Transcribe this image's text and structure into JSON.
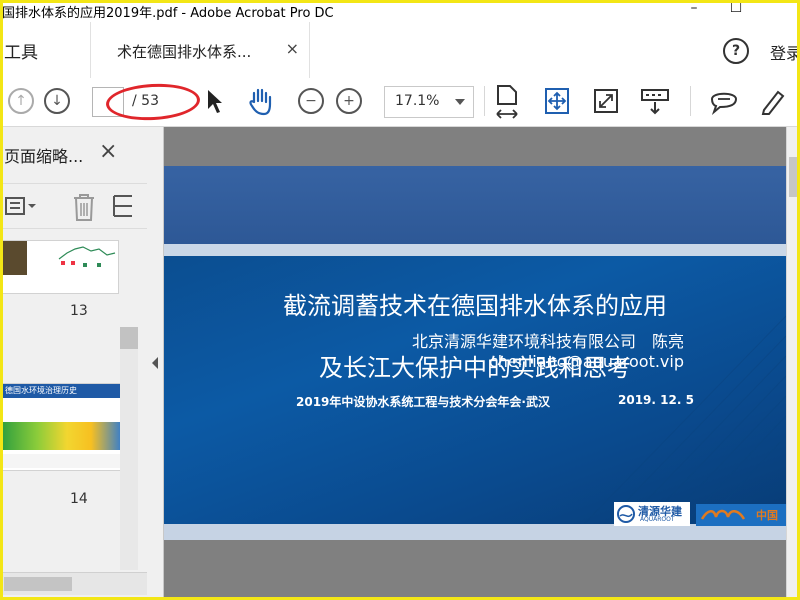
{
  "window": {
    "title": "国排水体系的应用2019年.pdf - Adobe Acrobat Pro DC",
    "controls": {
      "minimize": "–",
      "maximize": "☐"
    }
  },
  "tabs": {
    "tools_label": "工具",
    "document_tab": "术在德国排水体系...",
    "close_glyph": "×",
    "help_glyph": "?",
    "login_label": "登录"
  },
  "toolbar": {
    "page_current": "",
    "page_total": "/ 53",
    "zoom_value": "17.1%"
  },
  "panel": {
    "title": "页面缩略...",
    "close_glyph": "×",
    "thumbnails": [
      {
        "page_number": "13"
      },
      {
        "page_number": "14",
        "header_text": "德国水环境治理历史"
      }
    ]
  },
  "slide": {
    "title_line1": "截流调蓄技术在德国排水体系的应用",
    "title_line2": "及长江大保护中的实践和思考",
    "org_line": "北京清源华建环境科技有限公司　陈亮",
    "email": "chenliang@aquaroot.vip",
    "conference": "2019年中设协水系统工程与技术分会年会·武汉",
    "date": "2019. 12. 5",
    "logo1_text": "清源华建",
    "logo1_sub": "AQUAROOT",
    "logo2_text": "中国"
  },
  "colors": {
    "highlight_frame": "#f3e616",
    "annotation_oval": "#e0262b",
    "slide_blue": "#0c5aa5"
  }
}
